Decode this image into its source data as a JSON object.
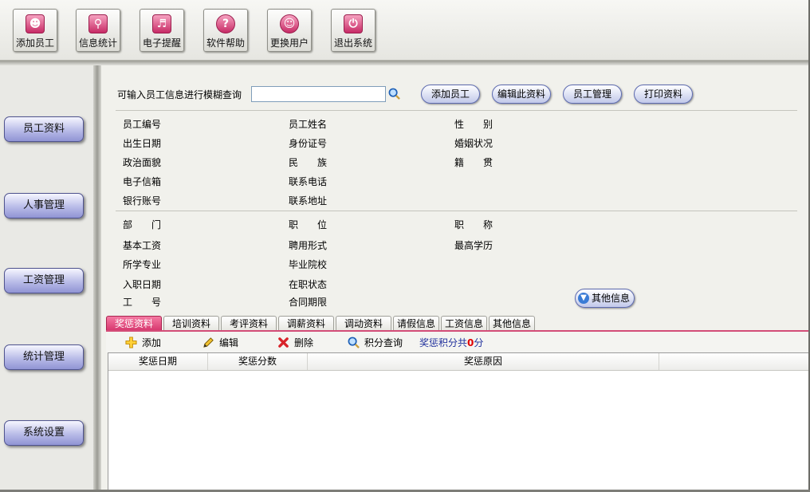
{
  "toolbar": {
    "buttons": [
      {
        "label": "添加员工",
        "icon": "user-icon"
      },
      {
        "label": "信息统计",
        "icon": "search-icon"
      },
      {
        "label": "电子提醒",
        "icon": "speaker-icon"
      },
      {
        "label": "软件帮助",
        "icon": "help-icon"
      },
      {
        "label": "更换用户",
        "icon": "users-icon"
      },
      {
        "label": "退出系统",
        "icon": "power-icon"
      }
    ]
  },
  "sidebar": {
    "items": [
      {
        "label": "员工资料"
      },
      {
        "label": "人事管理"
      },
      {
        "label": "工资管理"
      },
      {
        "label": "统计管理"
      },
      {
        "label": "系统设置"
      }
    ]
  },
  "search": {
    "label": "可输入员工信息进行模糊查询",
    "value": "",
    "placeholder": ""
  },
  "actions": {
    "add": "添加员工",
    "edit": "编辑此资料",
    "manage": "员工管理",
    "print": "打印资料"
  },
  "fields": {
    "group1": [
      [
        "员工编号",
        "员工姓名",
        "性　　别"
      ],
      [
        "出生日期",
        "身份证号",
        "婚姻状况"
      ],
      [
        "政治面貌",
        "民　　族",
        "籍　　贯"
      ],
      [
        "电子信箱",
        "联系电话",
        ""
      ],
      [
        "银行账号",
        "联系地址",
        ""
      ]
    ],
    "group2": [
      [
        "部　　门",
        "职　　位",
        "职　　称"
      ],
      [
        "基本工资",
        "聘用形式",
        "最高学历"
      ],
      [
        "所学专业",
        "毕业院校",
        ""
      ],
      [
        "入职日期",
        "在职状态",
        ""
      ],
      [
        "工　　号",
        "合同期限",
        ""
      ]
    ]
  },
  "other_info_label": "其他信息",
  "tabs": [
    "奖惩资料",
    "培训资料",
    "考评资料",
    "调薪资料",
    "调动资料",
    "请假信息",
    "工资信息",
    "其他信息"
  ],
  "grid_toolbar": {
    "add": "添加",
    "edit": "编辑",
    "delete": "删除",
    "query": "积分查询",
    "score_prefix": "奖惩积分共",
    "score_value": "0",
    "score_suffix": "分"
  },
  "grid": {
    "columns": [
      "奖惩日期",
      "奖惩分数",
      "奖惩原因"
    ]
  },
  "colors": {
    "accent_pink": "#d6356c",
    "pill_border": "#5d6bb0",
    "score_blue": "#1f2f9c",
    "score_red": "#e00000"
  }
}
